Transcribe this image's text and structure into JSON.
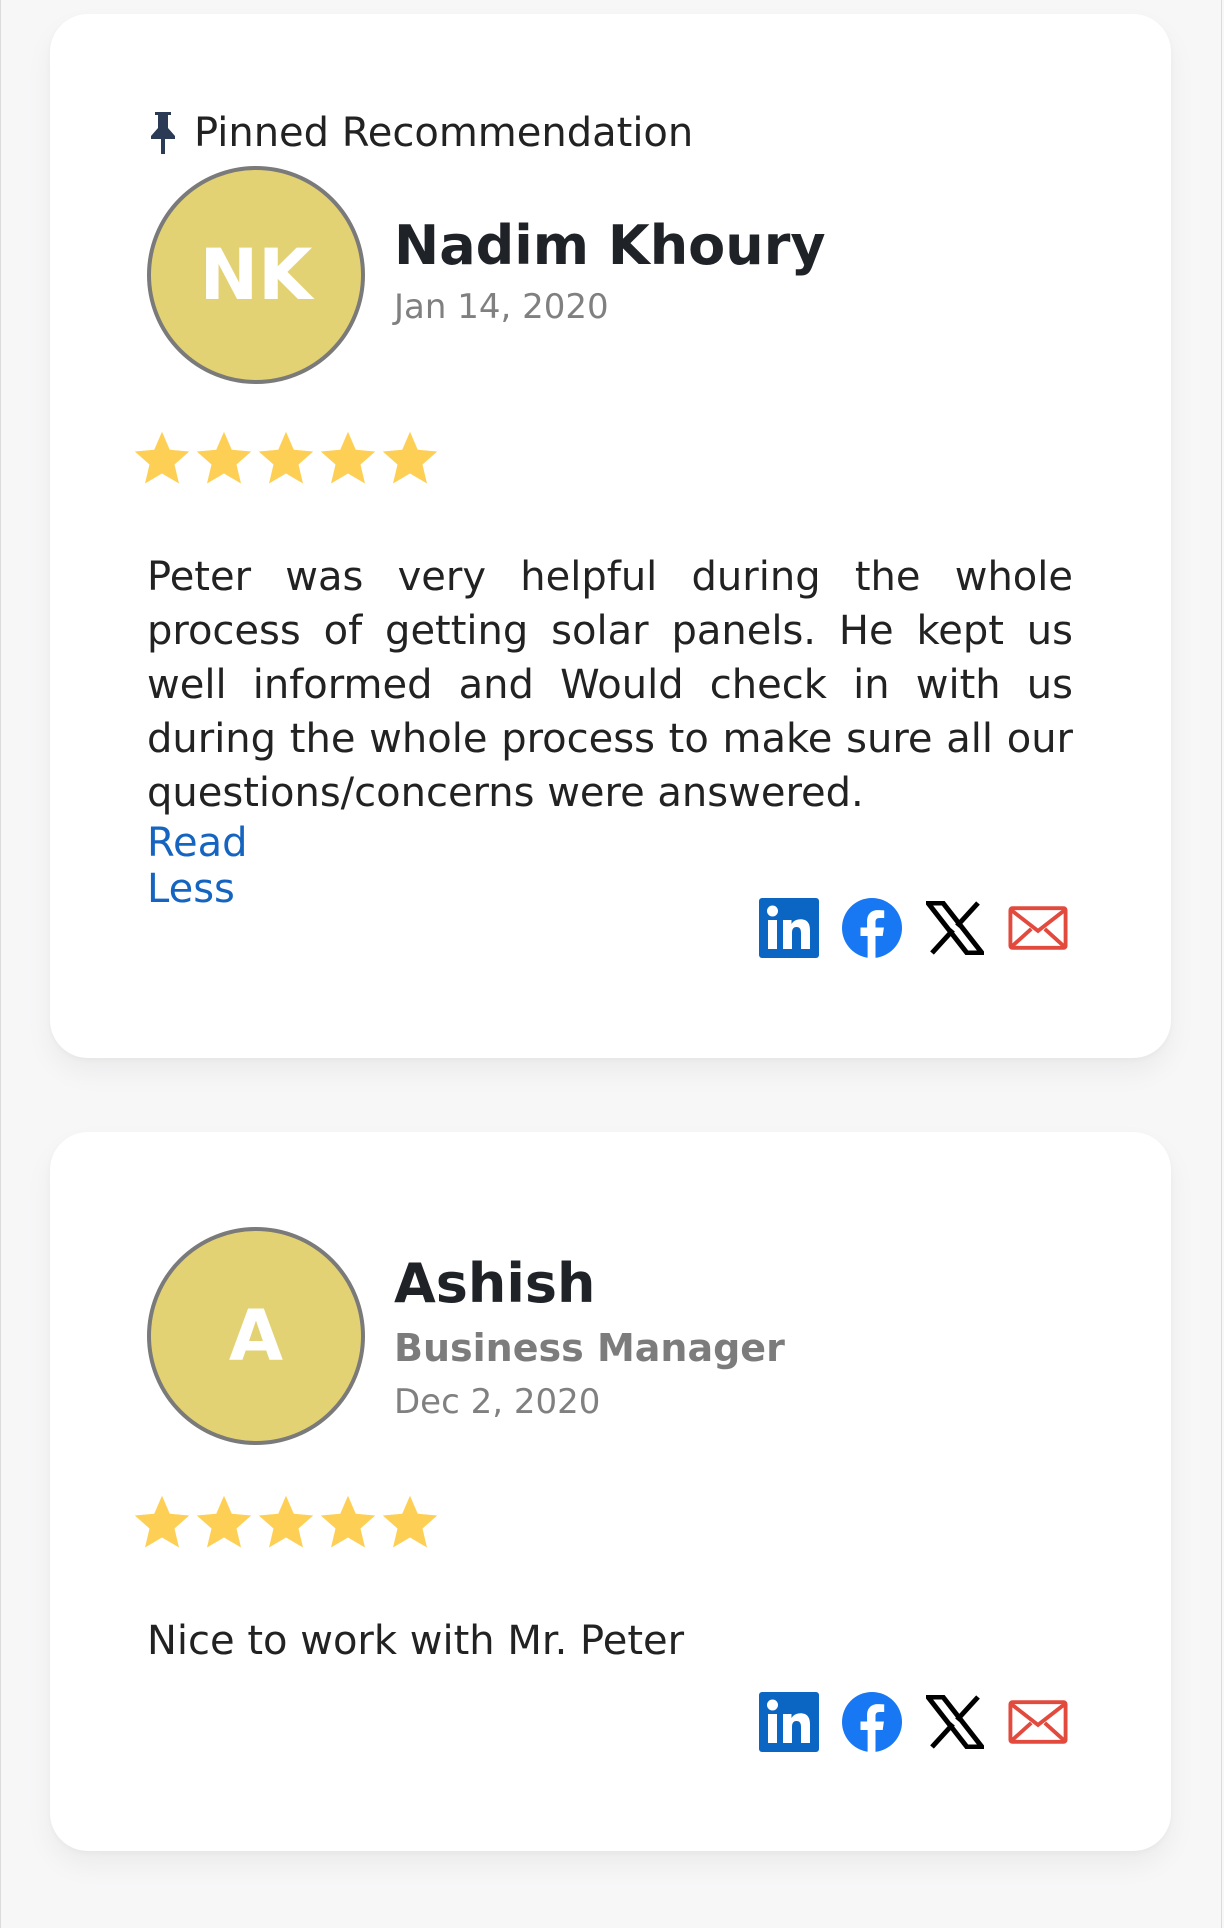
{
  "colors": {
    "avatar_bg": "#e3d274",
    "star": "#fdcf55",
    "link": "#1565c0",
    "linkedin": "#0a66c2",
    "facebook": "#1877f2",
    "x": "#000000",
    "email": "#e24a3d"
  },
  "reviews": [
    {
      "pinned_label": "Pinned Recommendation",
      "initials": "NK",
      "name": "Nadim Khoury",
      "date": "Jan 14, 2020",
      "rating": 5,
      "text": "Peter was very helpful during the whole process of getting solar panels. He kept us well informed and Would check in with us during the whole process to make sure all our questions/concerns were answered.",
      "toggle_label": "Read Less",
      "share_icons": [
        "linkedin-icon",
        "facebook-icon",
        "x-icon",
        "email-icon"
      ]
    },
    {
      "initials": "A",
      "name": "Ashish",
      "role": "Business Manager",
      "date": "Dec 2, 2020",
      "rating": 5,
      "text": "Nice to work with Mr. Peter",
      "share_icons": [
        "linkedin-icon",
        "facebook-icon",
        "x-icon",
        "email-icon"
      ]
    }
  ]
}
